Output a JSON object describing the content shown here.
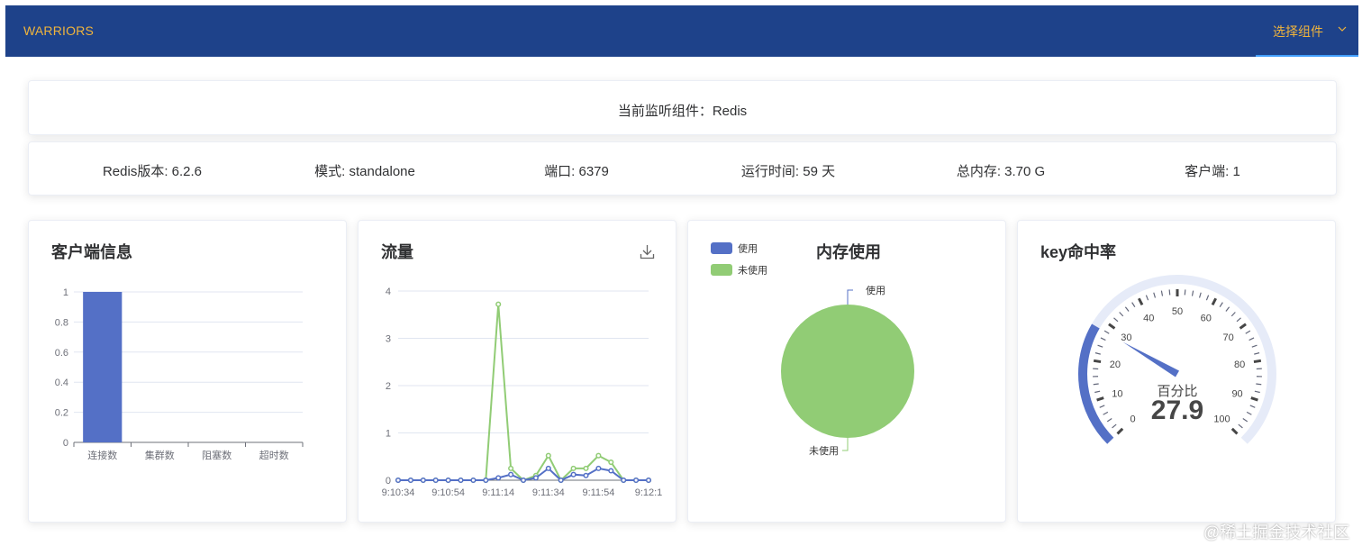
{
  "header": {
    "brand": "WARRIORS",
    "menu_label": "选择组件",
    "menu_icon": "chevron-down-icon",
    "background": "#1e428a",
    "text_color": "#f0b43c"
  },
  "monitor": {
    "text": "当前监听组件：Redis"
  },
  "stats": [
    "Redis版本: 6.2.6",
    "模式: standalone",
    "端口: 6379",
    "运行时间: 59 天",
    "总内存: 3.70 G",
    "客户端: 1"
  ],
  "cards": {
    "clients": {
      "title": "客户端信息"
    },
    "traffic": {
      "title": "流量",
      "download_icon": "download-icon"
    },
    "memory": {
      "title": "内存使用"
    },
    "hit_rate": {
      "title": "key命中率"
    }
  },
  "chart_data": [
    {
      "type": "bar",
      "title": "客户端信息",
      "categories": [
        "连接数",
        "集群数",
        "阻塞数",
        "超时数"
      ],
      "values": [
        1,
        0,
        0,
        0
      ],
      "ylim": [
        0,
        1
      ],
      "yticks": [
        "0",
        "0.2",
        "0.4",
        "0.6",
        "0.8",
        "1"
      ],
      "grid": true,
      "color": "#5470c6"
    },
    {
      "type": "line",
      "title": "流量",
      "x_labels": [
        "9:10:34",
        "9:10:54",
        "9:11:14",
        "9:11:34",
        "9:11:54",
        "9:12:1"
      ],
      "ylim": [
        0,
        4
      ],
      "yticks": [
        "0",
        "1",
        "2",
        "3",
        "4"
      ],
      "grid": true,
      "series": [
        {
          "color": "#91cc75",
          "values": [
            0,
            0,
            0,
            0,
            0,
            0,
            0,
            0,
            3.72,
            0.25,
            0,
            0.1,
            0.52,
            0,
            0.25,
            0.25,
            0.52,
            0.38,
            0,
            0,
            0
          ]
        },
        {
          "color": "#5470c6",
          "values": [
            0,
            0,
            0,
            0,
            0,
            0,
            0,
            0,
            0.05,
            0.12,
            0,
            0.05,
            0.25,
            0,
            0.12,
            0.1,
            0.25,
            0.2,
            0,
            0,
            0
          ]
        }
      ]
    },
    {
      "type": "pie",
      "title": "内存使用",
      "legend": [
        "使用",
        "未使用"
      ],
      "legend_position": "top-left",
      "categories": [
        "使用",
        "未使用"
      ],
      "values": [
        0,
        100
      ],
      "colors": [
        "#5470c6",
        "#91cc75"
      ]
    },
    {
      "type": "gauge",
      "title": "key命中率",
      "label": "百分比",
      "value": 27.9,
      "display_value": "27.9",
      "min": 0,
      "max": 100,
      "tick_labels": [
        "0",
        "10",
        "20",
        "30",
        "40",
        "50",
        "60",
        "70",
        "80",
        "90",
        "100"
      ],
      "progress_color": "#5470c6",
      "track_color": "#e6ebf8"
    }
  ],
  "watermark": "@稀土掘金技术社区"
}
